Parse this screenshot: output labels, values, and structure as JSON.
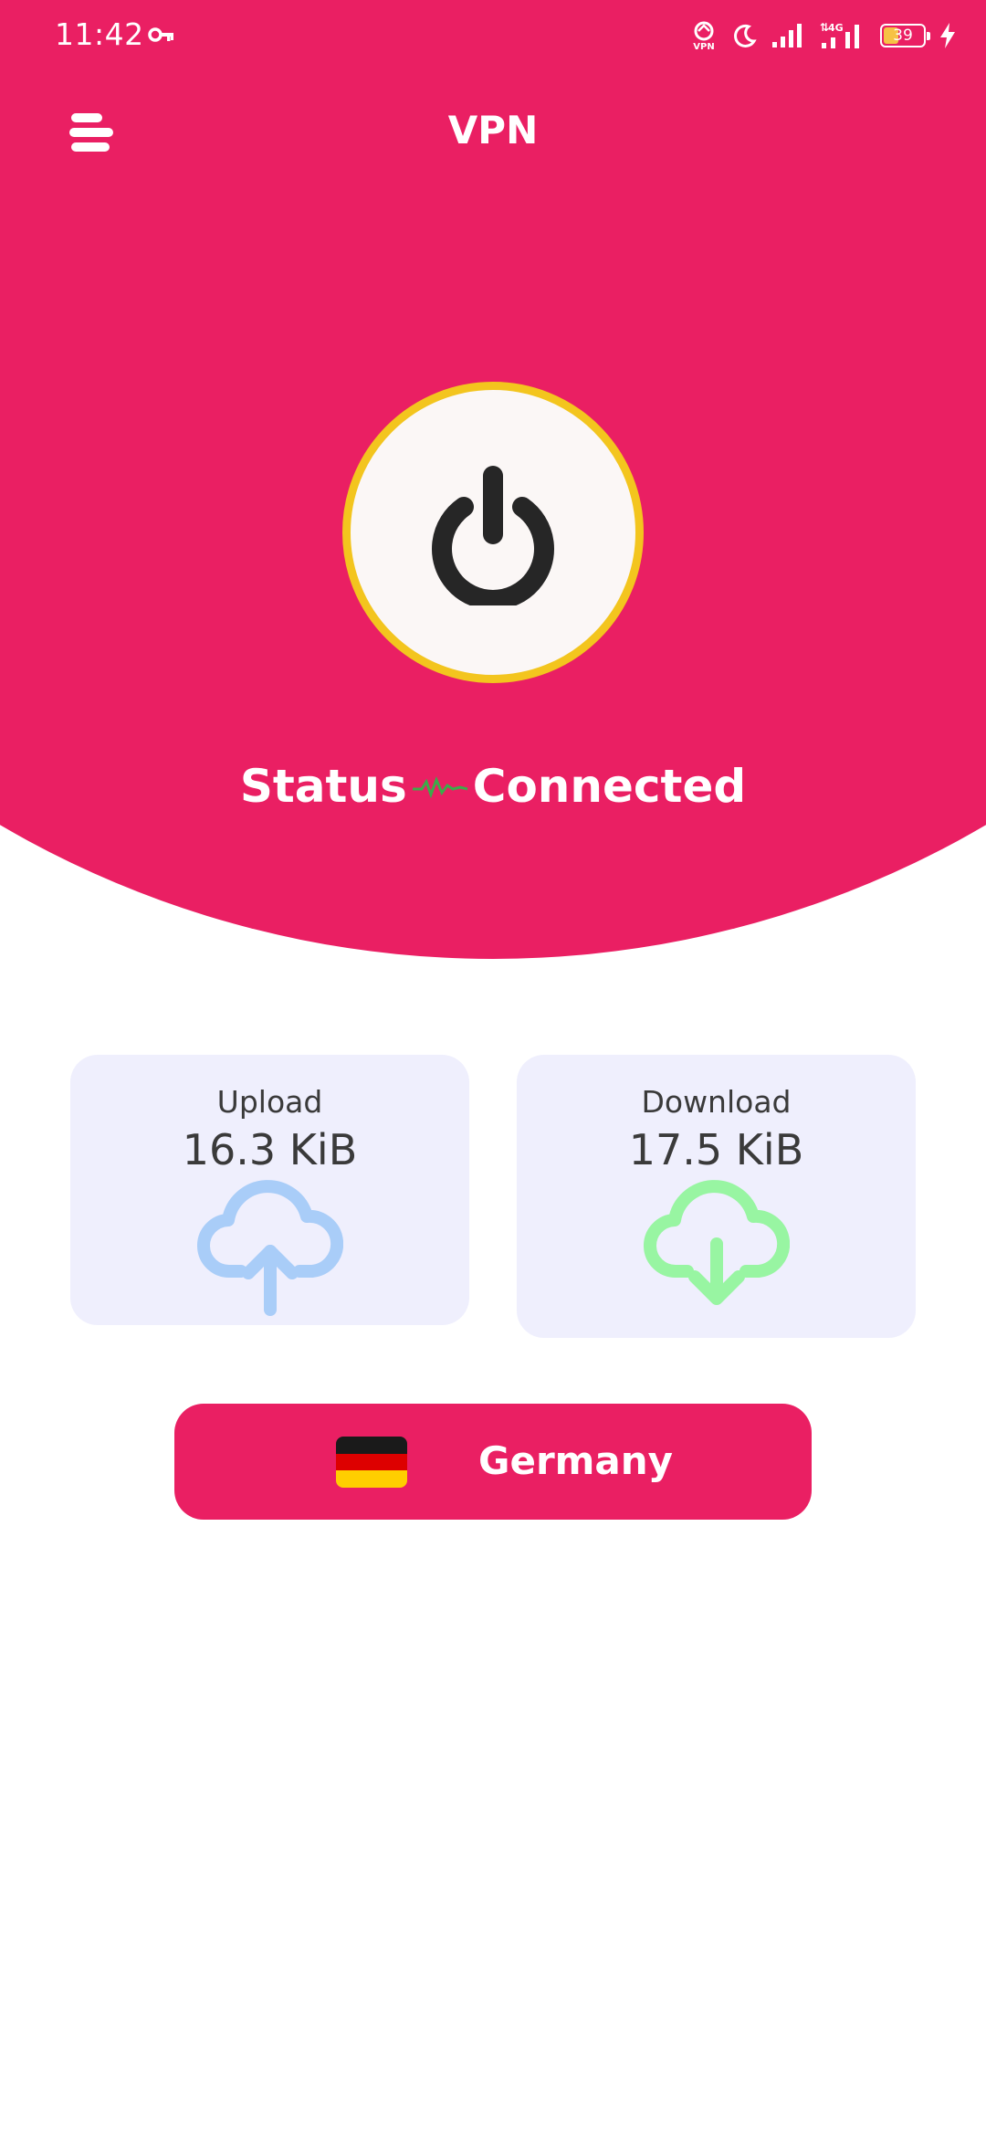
{
  "status_bar": {
    "time": "11:42",
    "battery_level": "39",
    "icons": [
      "vpn-key-icon",
      "vpn-status-icon",
      "moon-icon",
      "signal-icon",
      "4g-signal-icon",
      "battery-icon",
      "charging-icon"
    ],
    "network_label": "4G"
  },
  "app_bar": {
    "title": "VPN",
    "menu_icon": "menu-icon"
  },
  "power": {
    "icon": "power-icon",
    "ring_color": "#F3C51E"
  },
  "status": {
    "label": "Status",
    "value": "Connected",
    "pulse_color": "#3DAA4A"
  },
  "stats": {
    "upload": {
      "label": "Upload",
      "value": "16.3 KiB",
      "icon": "cloud-upload-icon",
      "color": "#A9CDF8"
    },
    "download": {
      "label": "Download",
      "value": "17.5 KiB",
      "icon": "cloud-download-icon",
      "color": "#98F5A2"
    }
  },
  "server": {
    "country": "Germany",
    "flag": "germany-flag",
    "flag_colors": [
      "#1a1a1a",
      "#DD0000",
      "#FFCE00"
    ]
  },
  "colors": {
    "primary": "#EA1F63",
    "card_bg": "#EFEFFD",
    "text_dark": "#3a3a3a"
  }
}
